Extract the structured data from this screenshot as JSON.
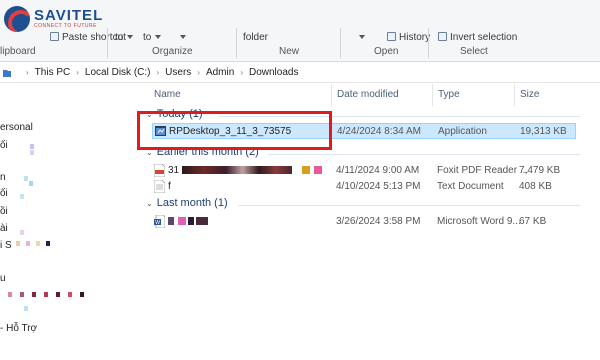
{
  "logo": {
    "name": "SAVITEL",
    "tagline": "CONNECT TO FUTURE"
  },
  "ribbon": {
    "clipboard_label": "lipboard",
    "paste_shortcut": "Paste shortcut",
    "move_to": "to",
    "copy_to": "to",
    "organize_label": "Organize",
    "new_folder": "folder",
    "new_label": "New",
    "history": "History",
    "open_label": "Open",
    "invert_selection": "Invert selection",
    "select_label": "Select"
  },
  "address": {
    "crumbs": [
      "This PC",
      "Local Disk (C:)",
      "Users",
      "Admin",
      "Downloads"
    ]
  },
  "nav": {
    "items": [
      "ersonal",
      "ối",
      "n",
      "ối",
      "ồi",
      "ài",
      "i S",
      "u",
      "- Hỗ Trợ"
    ]
  },
  "columns": {
    "name": "Name",
    "date": "Date modified",
    "type": "Type",
    "size": "Size"
  },
  "groups": [
    {
      "title": "Today (1)",
      "files": [
        {
          "name": "RPDesktop_3_11_3_73575",
          "date": "4/24/2024 8:34 AM",
          "type": "Application",
          "size": "19,313 KB",
          "icon": "application-icon"
        }
      ]
    },
    {
      "title": "Earlier this month (2)",
      "files": [
        {
          "name": "31",
          "date": "4/11/2024 9:00 AM",
          "type": "Foxit PDF Reader ...",
          "size": "7,479 KB",
          "icon": "pdf-icon"
        },
        {
          "name": "f",
          "date": "4/10/2024 5:13 PM",
          "type": "Text Document",
          "size": "408 KB",
          "icon": "text-document-icon"
        }
      ]
    },
    {
      "title": "Last month (1)",
      "files": [
        {
          "name": "",
          "date": "3/26/2024 3:58 PM",
          "type": "Microsoft Word 9...",
          "size": "67 KB",
          "icon": "word-icon"
        }
      ]
    }
  ],
  "colors": {
    "highlight": "#e01b1b",
    "selection": "#cce8ff",
    "group_title": "#1e3f73"
  }
}
